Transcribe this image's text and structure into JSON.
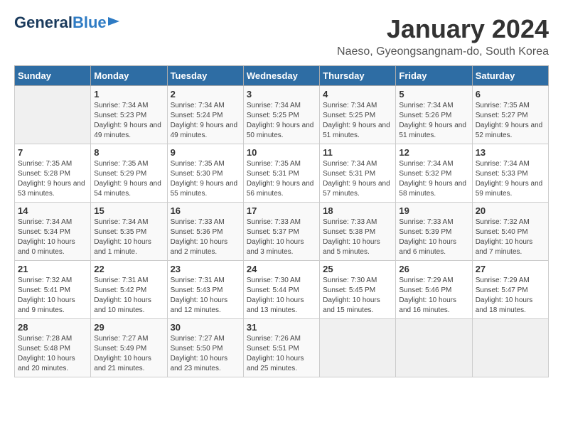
{
  "header": {
    "logo_line1": "General",
    "logo_line2": "Blue",
    "title": "January 2024",
    "subtitle": "Naeso, Gyeongsangnam-do, South Korea"
  },
  "days_of_week": [
    "Sunday",
    "Monday",
    "Tuesday",
    "Wednesday",
    "Thursday",
    "Friday",
    "Saturday"
  ],
  "weeks": [
    [
      {
        "day": "",
        "sunrise": "",
        "sunset": "",
        "daylight": ""
      },
      {
        "day": "1",
        "sunrise": "Sunrise: 7:34 AM",
        "sunset": "Sunset: 5:23 PM",
        "daylight": "Daylight: 9 hours and 49 minutes."
      },
      {
        "day": "2",
        "sunrise": "Sunrise: 7:34 AM",
        "sunset": "Sunset: 5:24 PM",
        "daylight": "Daylight: 9 hours and 49 minutes."
      },
      {
        "day": "3",
        "sunrise": "Sunrise: 7:34 AM",
        "sunset": "Sunset: 5:25 PM",
        "daylight": "Daylight: 9 hours and 50 minutes."
      },
      {
        "day": "4",
        "sunrise": "Sunrise: 7:34 AM",
        "sunset": "Sunset: 5:25 PM",
        "daylight": "Daylight: 9 hours and 51 minutes."
      },
      {
        "day": "5",
        "sunrise": "Sunrise: 7:34 AM",
        "sunset": "Sunset: 5:26 PM",
        "daylight": "Daylight: 9 hours and 51 minutes."
      },
      {
        "day": "6",
        "sunrise": "Sunrise: 7:35 AM",
        "sunset": "Sunset: 5:27 PM",
        "daylight": "Daylight: 9 hours and 52 minutes."
      }
    ],
    [
      {
        "day": "7",
        "sunrise": "Sunrise: 7:35 AM",
        "sunset": "Sunset: 5:28 PM",
        "daylight": "Daylight: 9 hours and 53 minutes."
      },
      {
        "day": "8",
        "sunrise": "Sunrise: 7:35 AM",
        "sunset": "Sunset: 5:29 PM",
        "daylight": "Daylight: 9 hours and 54 minutes."
      },
      {
        "day": "9",
        "sunrise": "Sunrise: 7:35 AM",
        "sunset": "Sunset: 5:30 PM",
        "daylight": "Daylight: 9 hours and 55 minutes."
      },
      {
        "day": "10",
        "sunrise": "Sunrise: 7:35 AM",
        "sunset": "Sunset: 5:31 PM",
        "daylight": "Daylight: 9 hours and 56 minutes."
      },
      {
        "day": "11",
        "sunrise": "Sunrise: 7:34 AM",
        "sunset": "Sunset: 5:31 PM",
        "daylight": "Daylight: 9 hours and 57 minutes."
      },
      {
        "day": "12",
        "sunrise": "Sunrise: 7:34 AM",
        "sunset": "Sunset: 5:32 PM",
        "daylight": "Daylight: 9 hours and 58 minutes."
      },
      {
        "day": "13",
        "sunrise": "Sunrise: 7:34 AM",
        "sunset": "Sunset: 5:33 PM",
        "daylight": "Daylight: 9 hours and 59 minutes."
      }
    ],
    [
      {
        "day": "14",
        "sunrise": "Sunrise: 7:34 AM",
        "sunset": "Sunset: 5:34 PM",
        "daylight": "Daylight: 10 hours and 0 minutes."
      },
      {
        "day": "15",
        "sunrise": "Sunrise: 7:34 AM",
        "sunset": "Sunset: 5:35 PM",
        "daylight": "Daylight: 10 hours and 1 minute."
      },
      {
        "day": "16",
        "sunrise": "Sunrise: 7:33 AM",
        "sunset": "Sunset: 5:36 PM",
        "daylight": "Daylight: 10 hours and 2 minutes."
      },
      {
        "day": "17",
        "sunrise": "Sunrise: 7:33 AM",
        "sunset": "Sunset: 5:37 PM",
        "daylight": "Daylight: 10 hours and 3 minutes."
      },
      {
        "day": "18",
        "sunrise": "Sunrise: 7:33 AM",
        "sunset": "Sunset: 5:38 PM",
        "daylight": "Daylight: 10 hours and 5 minutes."
      },
      {
        "day": "19",
        "sunrise": "Sunrise: 7:33 AM",
        "sunset": "Sunset: 5:39 PM",
        "daylight": "Daylight: 10 hours and 6 minutes."
      },
      {
        "day": "20",
        "sunrise": "Sunrise: 7:32 AM",
        "sunset": "Sunset: 5:40 PM",
        "daylight": "Daylight: 10 hours and 7 minutes."
      }
    ],
    [
      {
        "day": "21",
        "sunrise": "Sunrise: 7:32 AM",
        "sunset": "Sunset: 5:41 PM",
        "daylight": "Daylight: 10 hours and 9 minutes."
      },
      {
        "day": "22",
        "sunrise": "Sunrise: 7:31 AM",
        "sunset": "Sunset: 5:42 PM",
        "daylight": "Daylight: 10 hours and 10 minutes."
      },
      {
        "day": "23",
        "sunrise": "Sunrise: 7:31 AM",
        "sunset": "Sunset: 5:43 PM",
        "daylight": "Daylight: 10 hours and 12 minutes."
      },
      {
        "day": "24",
        "sunrise": "Sunrise: 7:30 AM",
        "sunset": "Sunset: 5:44 PM",
        "daylight": "Daylight: 10 hours and 13 minutes."
      },
      {
        "day": "25",
        "sunrise": "Sunrise: 7:30 AM",
        "sunset": "Sunset: 5:45 PM",
        "daylight": "Daylight: 10 hours and 15 minutes."
      },
      {
        "day": "26",
        "sunrise": "Sunrise: 7:29 AM",
        "sunset": "Sunset: 5:46 PM",
        "daylight": "Daylight: 10 hours and 16 minutes."
      },
      {
        "day": "27",
        "sunrise": "Sunrise: 7:29 AM",
        "sunset": "Sunset: 5:47 PM",
        "daylight": "Daylight: 10 hours and 18 minutes."
      }
    ],
    [
      {
        "day": "28",
        "sunrise": "Sunrise: 7:28 AM",
        "sunset": "Sunset: 5:48 PM",
        "daylight": "Daylight: 10 hours and 20 minutes."
      },
      {
        "day": "29",
        "sunrise": "Sunrise: 7:27 AM",
        "sunset": "Sunset: 5:49 PM",
        "daylight": "Daylight: 10 hours and 21 minutes."
      },
      {
        "day": "30",
        "sunrise": "Sunrise: 7:27 AM",
        "sunset": "Sunset: 5:50 PM",
        "daylight": "Daylight: 10 hours and 23 minutes."
      },
      {
        "day": "31",
        "sunrise": "Sunrise: 7:26 AM",
        "sunset": "Sunset: 5:51 PM",
        "daylight": "Daylight: 10 hours and 25 minutes."
      },
      {
        "day": "",
        "sunrise": "",
        "sunset": "",
        "daylight": ""
      },
      {
        "day": "",
        "sunrise": "",
        "sunset": "",
        "daylight": ""
      },
      {
        "day": "",
        "sunrise": "",
        "sunset": "",
        "daylight": ""
      }
    ]
  ]
}
